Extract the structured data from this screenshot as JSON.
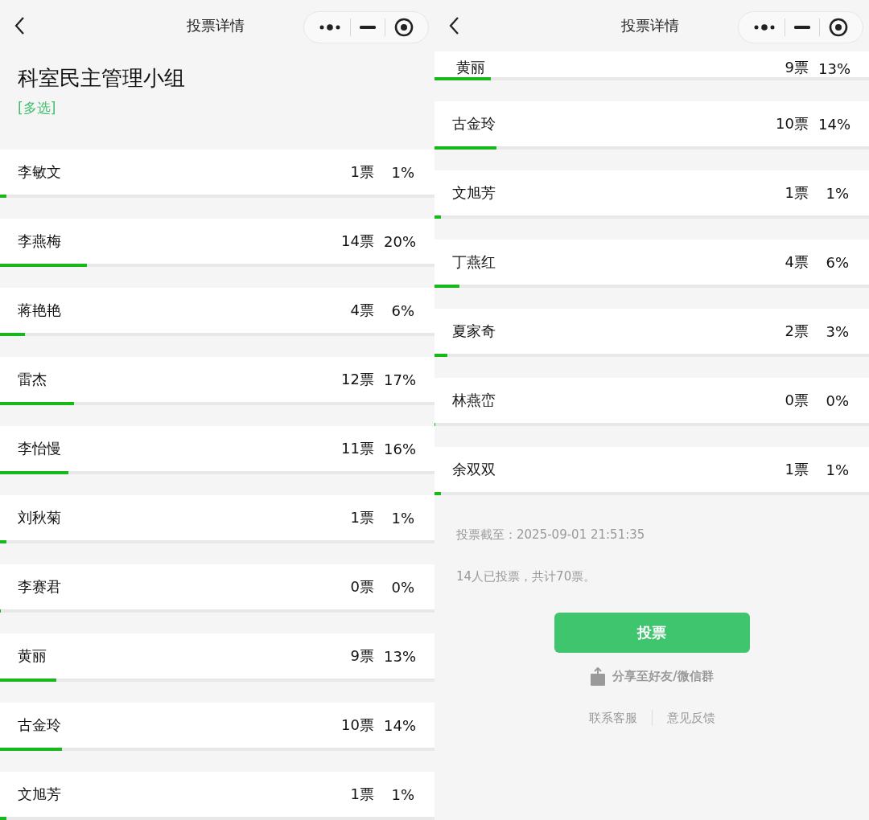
{
  "panels": [
    {
      "nav": {
        "title": "投票详情"
      },
      "poll": {
        "title": "科室民主管理小组",
        "mode": "[多选]"
      },
      "options": [
        {
          "name": "李敏文",
          "votes": "1票",
          "percent": "1%",
          "level": 0.014
        },
        {
          "name": "李燕梅",
          "votes": "14票",
          "percent": "20%",
          "level": 0.2
        },
        {
          "name": "蒋艳艳",
          "votes": "4票",
          "percent": "6%",
          "level": 0.057
        },
        {
          "name": "雷杰",
          "votes": "12票",
          "percent": "17%",
          "level": 0.171
        },
        {
          "name": "李怡慢",
          "votes": "11票",
          "percent": "16%",
          "level": 0.157
        },
        {
          "name": "刘秋菊",
          "votes": "1票",
          "percent": "1%",
          "level": 0.014
        },
        {
          "name": "李赛君",
          "votes": "0票",
          "percent": "0%",
          "level": 0
        },
        {
          "name": "黄丽",
          "votes": "9票",
          "percent": "13%",
          "level": 0.129
        },
        {
          "name": "古金玲",
          "votes": "10票",
          "percent": "14%",
          "level": 0.143
        },
        {
          "name": "文旭芳",
          "votes": "1票",
          "percent": "1%",
          "level": 0.014
        }
      ]
    },
    {
      "nav": {
        "title": "投票详情"
      },
      "options": [
        {
          "name": "黄丽",
          "votes": "9票",
          "percent": "13%",
          "level": 0.129
        },
        {
          "name": "古金玲",
          "votes": "10票",
          "percent": "14%",
          "level": 0.143
        },
        {
          "name": "文旭芳",
          "votes": "1票",
          "percent": "1%",
          "level": 0.014
        },
        {
          "name": "丁燕红",
          "votes": "4票",
          "percent": "6%",
          "level": 0.057
        },
        {
          "name": "夏家奇",
          "votes": "2票",
          "percent": "3%",
          "level": 0.029
        },
        {
          "name": "林燕峦",
          "votes": "0票",
          "percent": "0%",
          "level": 0
        },
        {
          "name": "余双双",
          "votes": "1票",
          "percent": "1%",
          "level": 0.014
        }
      ],
      "footer": {
        "deadline": "投票截至：2025-09-01 21:51:35",
        "summary": "14人已投票，共计70票。",
        "vote_button": "投票",
        "share": "分享至好友/微信群",
        "links": [
          "联系客服",
          "意见反馈"
        ]
      }
    }
  ]
}
